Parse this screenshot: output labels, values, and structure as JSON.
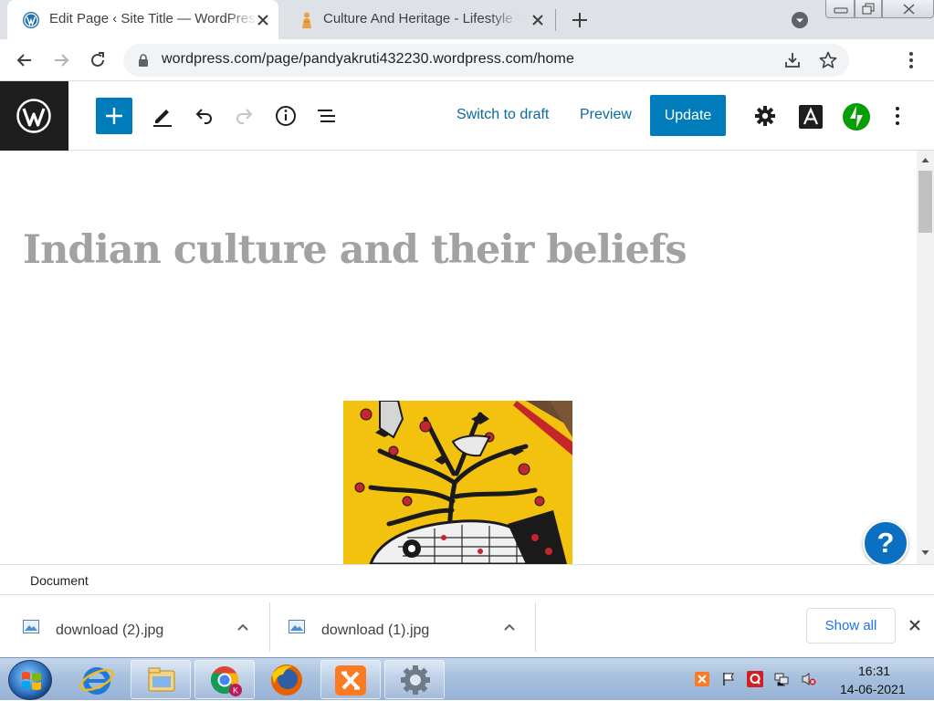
{
  "browser": {
    "tabs": [
      {
        "title": "Edit Page ‹ Site Title — WordPress",
        "favicon": "wordpress-icon",
        "active": true
      },
      {
        "title": "Culture And Heritage - Lifestyle Vi",
        "favicon": "indian-figure-icon",
        "active": false
      }
    ],
    "url": "wordpress.com/page/pandyakruti432230.wordpress.com/home",
    "profile_initial": "K",
    "profile_color": "#c2185b"
  },
  "editor_toolbar": {
    "switch_to_draft": "Switch to draft",
    "preview": "Preview",
    "update": "Update",
    "accent": "#007cba"
  },
  "content": {
    "page_title": "Indian culture and their beliefs",
    "image_subject": "madhubani-painting-tree-elephant"
  },
  "help_button": {
    "label": "?"
  },
  "status_bar": {
    "breadcrumb": "Document"
  },
  "downloads": {
    "items": [
      {
        "name": "download (2).jpg"
      },
      {
        "name": "download (1).jpg"
      }
    ],
    "show_all": "Show all"
  },
  "taskbar": {
    "pinned": [
      "internet-explorer-icon",
      "file-explorer-icon",
      "chrome-icon",
      "firefox-icon",
      "xampp-icon",
      "settings-gear-icon"
    ],
    "time": "16:31",
    "date": "14-06-2021"
  }
}
